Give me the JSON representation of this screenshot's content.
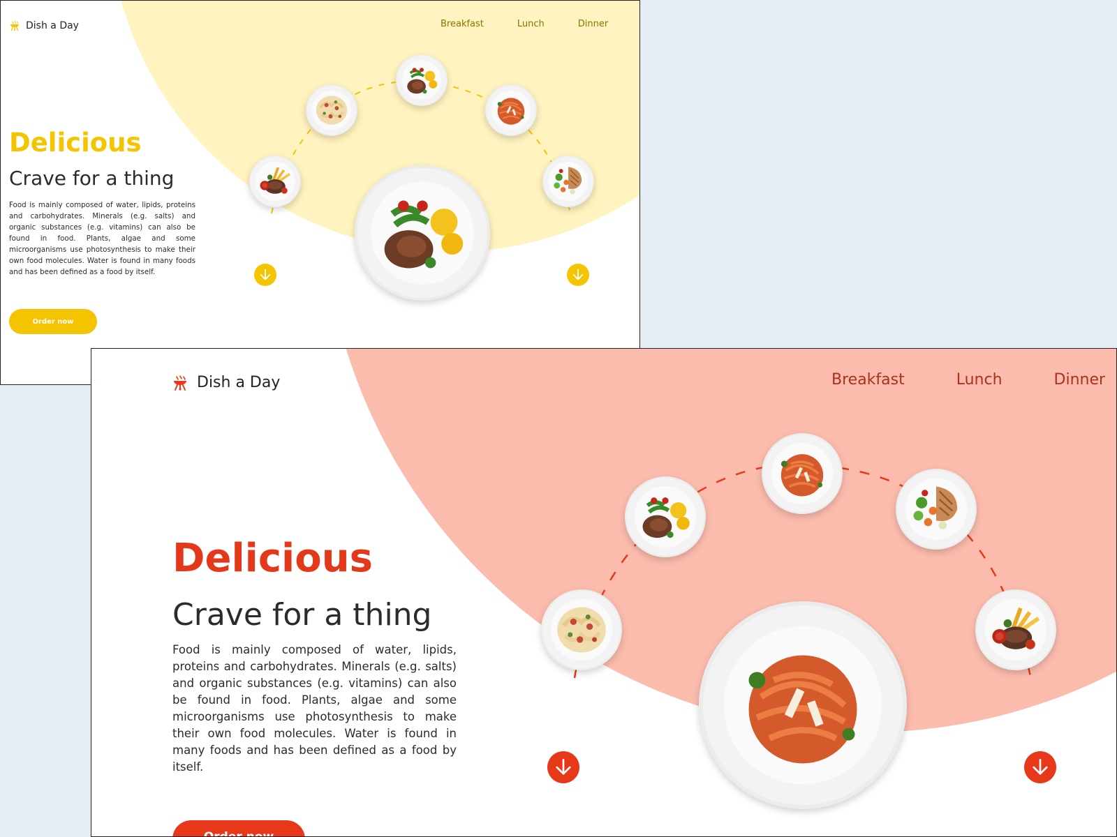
{
  "colors": {
    "yellow_accent": "#f5c400",
    "yellow_bg": "#fff3bf",
    "red_accent": "#e8381a",
    "red_bg": "#fcbcad",
    "backdrop": "#e6ecf4"
  },
  "yellow_card": {
    "brand": {
      "icon": "grill-icon",
      "name": "Dish a Day"
    },
    "nav": [
      "Breakfast",
      "Lunch",
      "Dinner"
    ],
    "title": "Delicious",
    "subtitle": "Crave for a thing",
    "body": "Food is mainly composed of water, lipids, proteins and carbohydrates. Minerals (e.g. salts) and organic substances (e.g. vitamins) can also be found in food. Plants, algae and some microorganisms use photosynthesis to make their own food molecules. Water is found in many foods and has been defined as a food by itself.",
    "cta": "Order now",
    "dishes": [
      "steak-fries-dish",
      "pasta-bacon-dish",
      "steak-salad-dish",
      "spaghetti-dish",
      "grilled-fish-veg-dish"
    ],
    "featured_dish": "steak-salad-potato-dish",
    "scroll_icons": [
      "arrow-down-icon",
      "arrow-down-icon"
    ]
  },
  "red_card": {
    "brand": {
      "icon": "grill-icon",
      "name": "Dish a Day"
    },
    "nav": [
      "Breakfast",
      "Lunch",
      "Dinner"
    ],
    "title": "Delicious",
    "subtitle": "Crave for a thing",
    "body": "Food is mainly composed of water, lipids, proteins and carbohydrates. Minerals (e.g. salts) and organic substances (e.g. vitamins) can also be found in food. Plants, algae and some microorganisms use photosynthesis to make their own food molecules. Water is found in many foods and has been defined as a food by itself.",
    "cta": "Order now",
    "dishes": [
      "pasta-bacon-dish",
      "steak-salad-dish",
      "spaghetti-dish",
      "grilled-fish-veg-dish",
      "steak-fries-dish"
    ],
    "featured_dish": "spaghetti-featured-dish",
    "scroll_icons": [
      "arrow-down-icon",
      "arrow-down-icon"
    ]
  }
}
